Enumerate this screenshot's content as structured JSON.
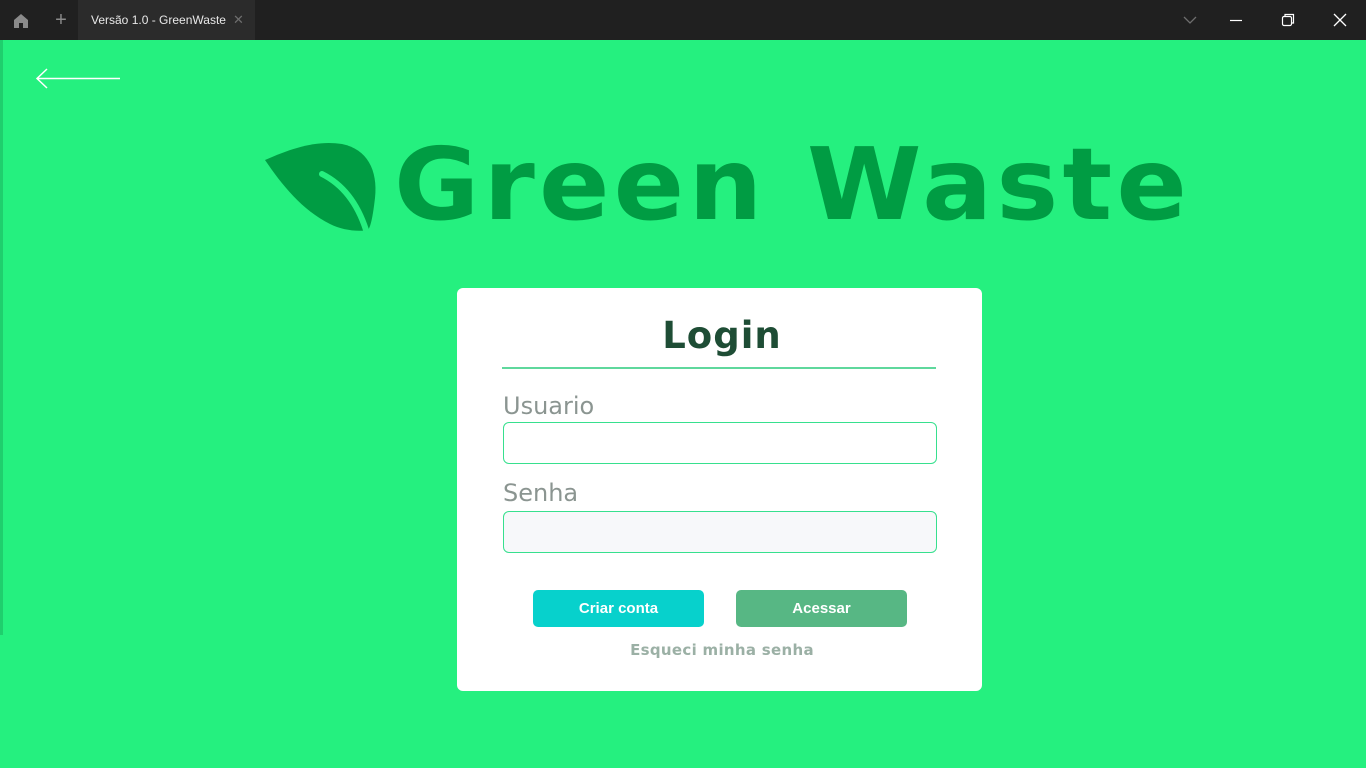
{
  "window": {
    "tab_title": "Versão 1.0 - GreenWaste",
    "new_tab_symbol": "+",
    "close_tab_symbol": "✕",
    "icons": [
      "home-icon",
      "chevron-down-icon",
      "minimize-icon",
      "restore-icon",
      "close-icon"
    ]
  },
  "header": {
    "back_icon": "arrow-left-icon",
    "logo_text": "Green Waste",
    "logo_icon": "leaf-icon"
  },
  "login": {
    "title": "Login",
    "username_label": "Usuario",
    "username_value": "",
    "password_label": "Senha",
    "password_value": "",
    "create_account_label": "Criar conta",
    "access_label": "Acessar",
    "forgot_password_label": "Esqueci minha senha"
  },
  "colors": {
    "background": "#25f07f",
    "logo": "#009c43",
    "create_button": "#07d1cc",
    "access_button": "#57b784",
    "title": "#1e4d35"
  }
}
